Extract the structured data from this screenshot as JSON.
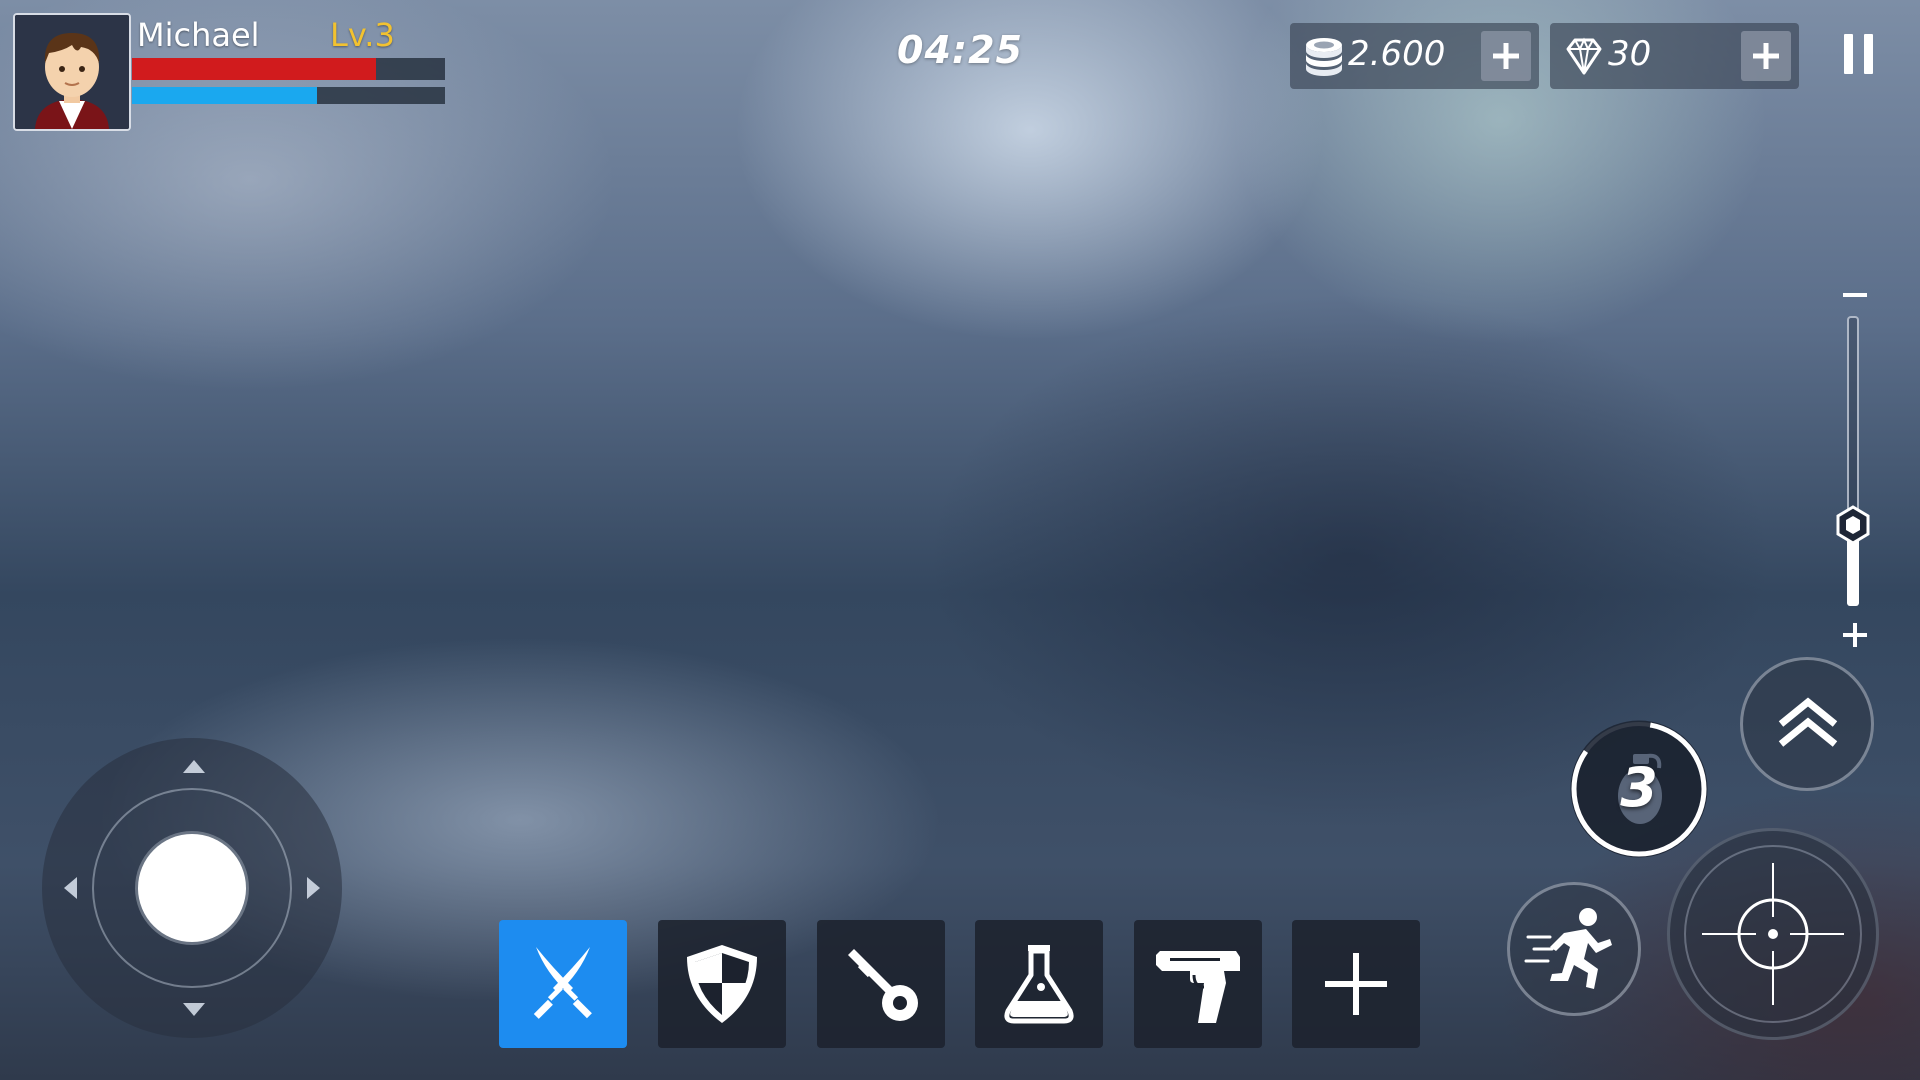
{
  "player": {
    "name": "Michael",
    "level": "Lv.3",
    "health_fraction": 0.78,
    "mana_fraction": 0.59
  },
  "timer": "04:25",
  "currencies": {
    "coins": {
      "icon": "coin-stack-icon",
      "value": "2.600"
    },
    "gems": {
      "icon": "diamond-icon",
      "value": "30"
    }
  },
  "zoom": {
    "level_fraction": 0.28
  },
  "grenade": {
    "count": "3",
    "cooldown_fraction": 0.82
  },
  "skills": [
    {
      "icon": "crossed-swords-icon",
      "active": true
    },
    {
      "icon": "shield-icon",
      "active": false
    },
    {
      "icon": "key-icon",
      "active": false
    },
    {
      "icon": "potion-flask-icon",
      "active": false
    },
    {
      "icon": "pistol-icon",
      "active": false
    },
    {
      "icon": "plus-icon",
      "active": false
    }
  ],
  "colors": {
    "health": "#d11b1d",
    "mana": "#1aa8ef",
    "level": "#f2c230",
    "active_slot": "#1d8cf0"
  }
}
